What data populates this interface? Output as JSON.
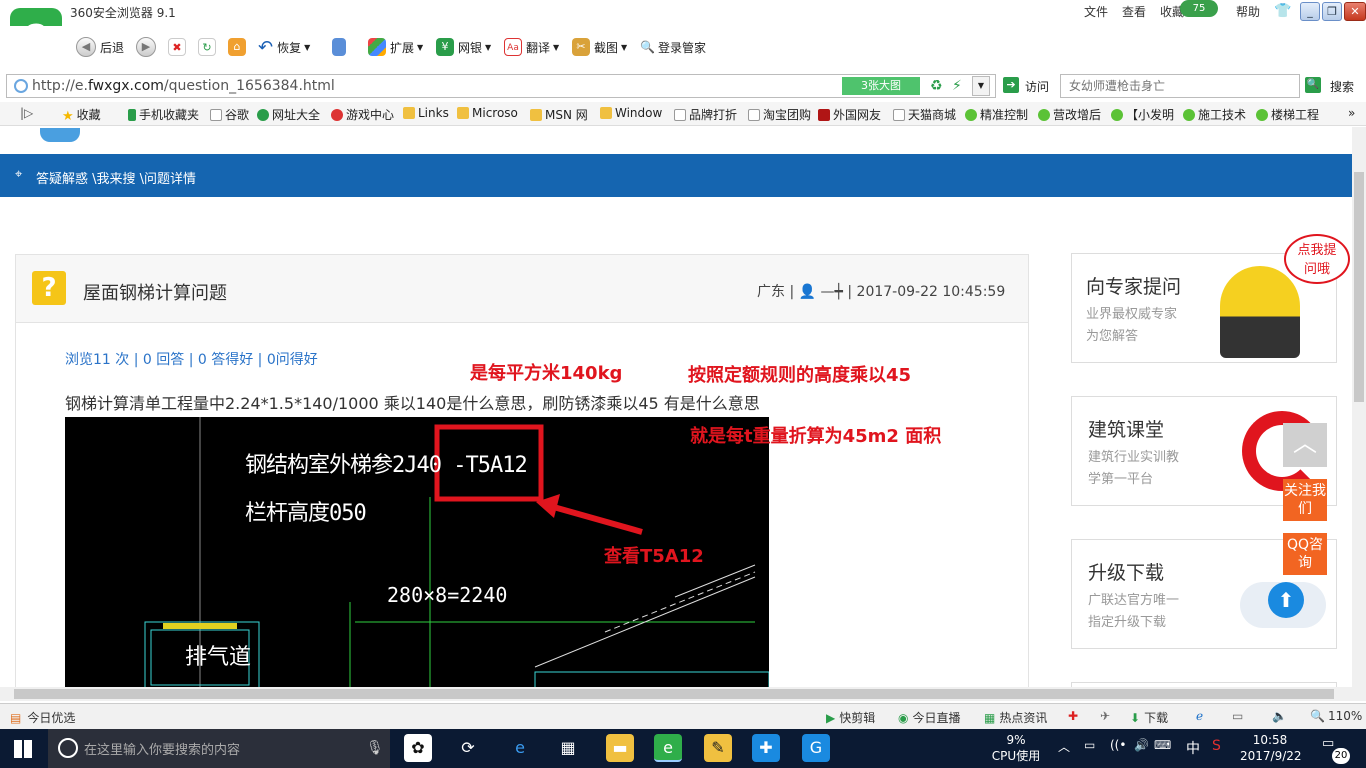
{
  "browser": {
    "title": "360安全浏览器 9.1",
    "menu": [
      "文件",
      "查看",
      "收藏",
      "帮助"
    ],
    "badge": "75",
    "toolbar": {
      "back": "后退",
      "restore": "恢复",
      "extend": "扩展",
      "bank": "网银",
      "translate": "翻译",
      "screenshot": "截图",
      "login": "登录管家"
    },
    "address": {
      "prefix": "http://e.",
      "domain": "fwxgx.com",
      "path": "/question_1656384.html",
      "images_btn": "3张大图",
      "visit": "访问"
    },
    "search": {
      "placeholder": "女幼师遭枪击身亡",
      "button": "搜索"
    },
    "favorites": [
      "收藏",
      "手机收藏夹",
      "谷歌",
      "网址大全",
      "游戏中心",
      "Links",
      "Microso",
      "MSN 网",
      "Window",
      "品牌打折",
      "淘宝团购",
      "外国网友",
      "天猫商城",
      "精准控制",
      "营改增后",
      "【小发明",
      "施工技术",
      "楼梯工程"
    ]
  },
  "page": {
    "breadcrumb": "答疑解惑 \\我来搜 \\问题详情",
    "question": {
      "title": "屋面钢梯计算问题",
      "meta": "广东 | 👤 —┿ | 2017-09-22 10:45:59",
      "stats": "浏览11 次 | 0 回答 | 0 答得好 | 0问得好",
      "text": "钢梯计算清单工程量中2.24*1.5*140/1000   乘以140是什么意思，刷防锈漆乘以45 有是什么意思"
    },
    "annotations": {
      "a1": "是每平方米140kg",
      "a2": "按照定额规则的高度乘以45",
      "a3": "就是每t重量折算为45m2 面积",
      "a4": "查看T5A12"
    },
    "drawing": {
      "line1": "钢结构室外梯参2J40 -T5A12",
      "line2": "栏杆高度050",
      "dim": "280×8=2240",
      "vent": "排气道"
    },
    "sidebar": [
      {
        "title": "向专家提问",
        "sub1": "业界最权威专家",
        "sub2": "为您解答"
      },
      {
        "title": "建筑课堂",
        "sub1": "建筑行业实训教",
        "sub2": "学第一平台"
      },
      {
        "title": "升级下载",
        "sub1": "广联达官方唯一",
        "sub2": "指定升级下载"
      }
    ],
    "bubble": "点我提问哦",
    "float_follow": "关注我们",
    "float_qq": "QQ咨询"
  },
  "statusbar": {
    "left": "今日优选",
    "items": [
      "快剪辑",
      "今日直播",
      "热点资讯",
      "下载"
    ],
    "zoom": "110%"
  },
  "taskbar": {
    "search_placeholder": "在这里输入你要搜索的内容",
    "cpu": "9%",
    "cpu_label": "CPU使用",
    "ime": "中",
    "time": "10:58",
    "date": "2017/9/22",
    "notif": "20"
  },
  "colors": {
    "brand_blue": "#1565b0",
    "annotation_red": "#e0151e",
    "accent_orange": "#f26522",
    "link_blue": "#2a73c8"
  }
}
